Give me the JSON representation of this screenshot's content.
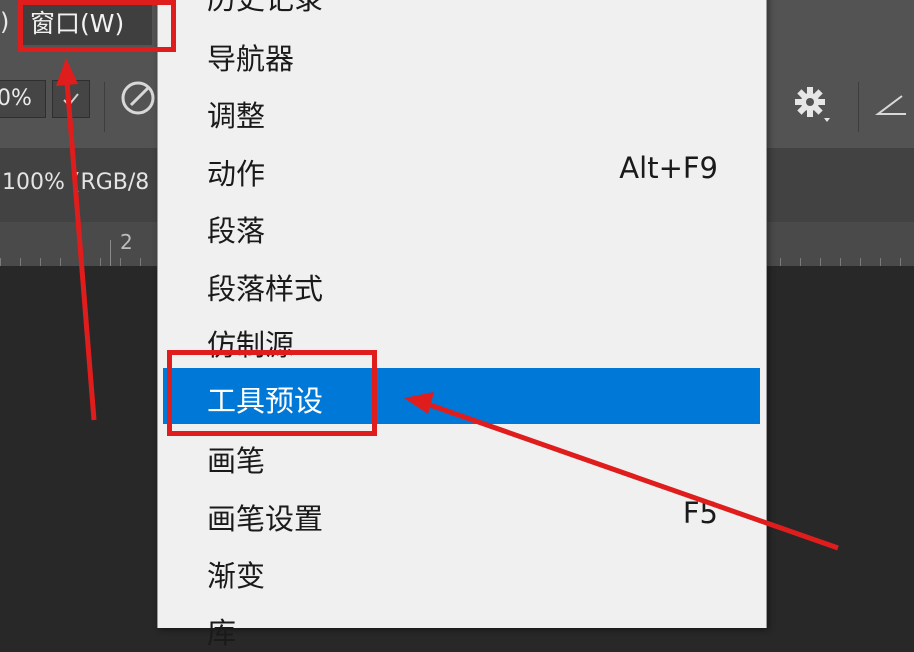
{
  "menubar": {
    "left_fragment": ")",
    "window_menu_label": "窗口(W)"
  },
  "options_bar": {
    "opacity_value": "0%",
    "icons": [
      "check-icon",
      "airbrush-icon",
      "gear-icon",
      "angle-icon"
    ]
  },
  "document": {
    "tab_title": "100% (RGB/8"
  },
  "ruler": {
    "label": "2"
  },
  "window_dropdown": {
    "items": [
      {
        "label": "历史记录",
        "shortcut": ""
      },
      {
        "label": "导航器",
        "shortcut": ""
      },
      {
        "label": "调整",
        "shortcut": ""
      },
      {
        "label": "动作",
        "shortcut": "Alt+F9"
      },
      {
        "label": "段落",
        "shortcut": ""
      },
      {
        "label": "段落样式",
        "shortcut": ""
      },
      {
        "label": "仿制源",
        "shortcut": ""
      },
      {
        "label": "工具预设",
        "shortcut": ""
      },
      {
        "label": "画笔",
        "shortcut": ""
      },
      {
        "label": "画笔设置",
        "shortcut": "F5"
      },
      {
        "label": "渐变",
        "shortcut": ""
      },
      {
        "label": "库",
        "shortcut": ""
      }
    ],
    "selected_item": "工具预设"
  },
  "colors": {
    "selection": "#0078d7",
    "annotation": "#e01d1d",
    "menu_background": "#f0f0f0",
    "app_background": "#535353"
  }
}
